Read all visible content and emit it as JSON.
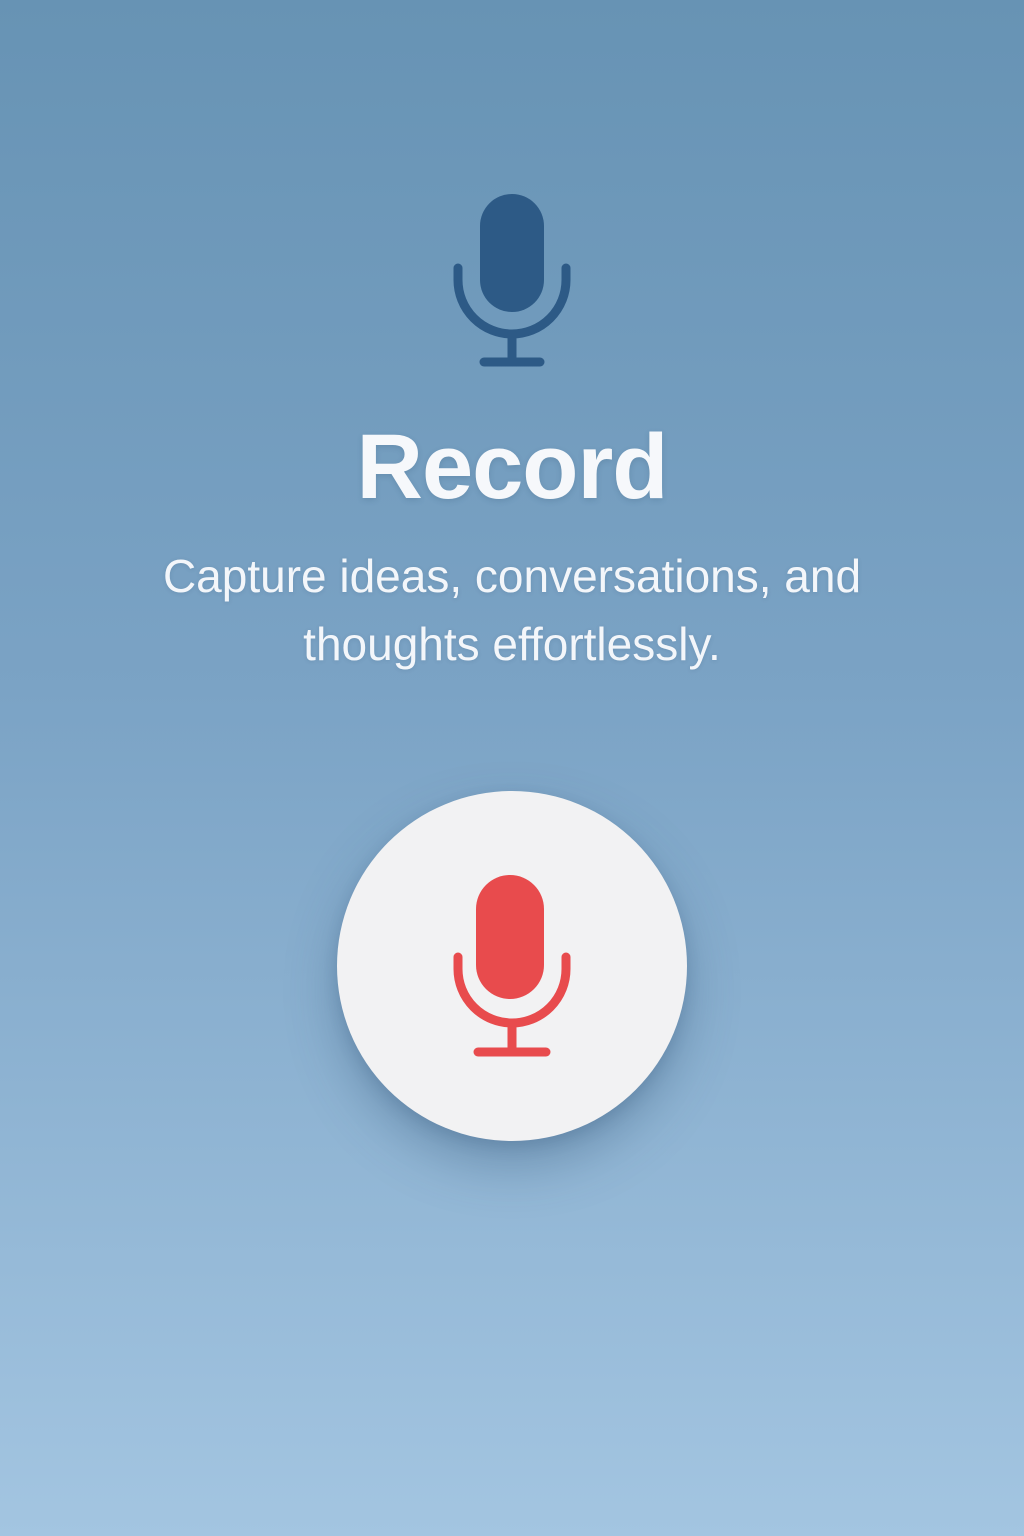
{
  "header": {
    "icon": "microphone-icon",
    "icon_color": "#2d5a86"
  },
  "title": "Record",
  "subtitle": "Capture ideas, conversations, and thoughts effortlessly.",
  "record_button": {
    "icon": "microphone-icon",
    "icon_color": "#e84b4d",
    "background": "#f2f2f3"
  },
  "colors": {
    "background_top": "#6793b4",
    "background_bottom": "#a3c5e1",
    "text": "#f6f8fb"
  }
}
